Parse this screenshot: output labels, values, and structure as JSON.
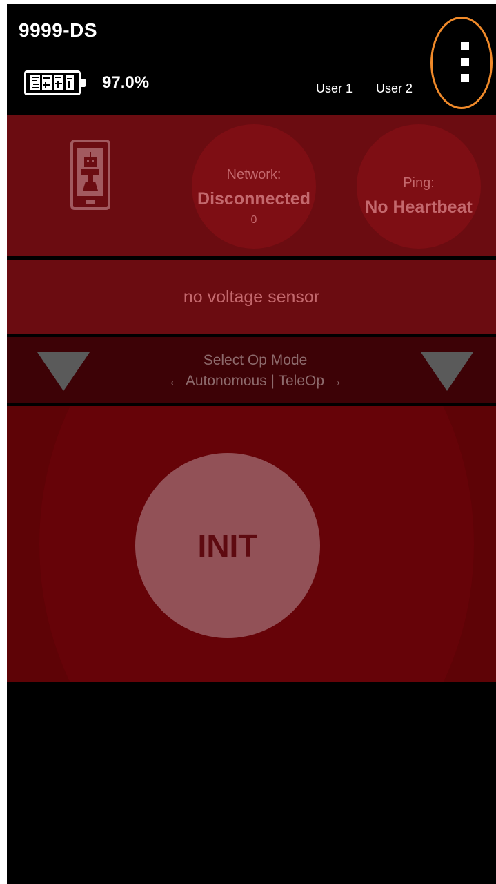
{
  "header": {
    "device_name": "9999-DS",
    "battery": {
      "icon": "battery-icon",
      "percent": "97.0%"
    },
    "users": [
      "User 1",
      "User 2"
    ],
    "menu_icon": "overflow-menu-icon",
    "menu_highlight_color": "#f08a2a"
  },
  "status": {
    "robot_icon": "robot-phone-icon",
    "network": {
      "label": "Network:",
      "value": "Disconnected",
      "count": "0"
    },
    "ping": {
      "label": "Ping:",
      "value": "No Heartbeat"
    }
  },
  "voltage": {
    "text": "no voltage sensor"
  },
  "opmode": {
    "title": "Select Op Mode",
    "hint": "← Autonomous | TeleOp →",
    "left_icon": "autonomous-dropdown-triangle-icon",
    "right_icon": "teleop-dropdown-triangle-icon"
  },
  "init": {
    "label": "INIT"
  },
  "colors": {
    "panel": "#6b0c11",
    "opmode_bar": "#3d0206",
    "init_area": "#5e0306",
    "init_button": "#925157"
  }
}
